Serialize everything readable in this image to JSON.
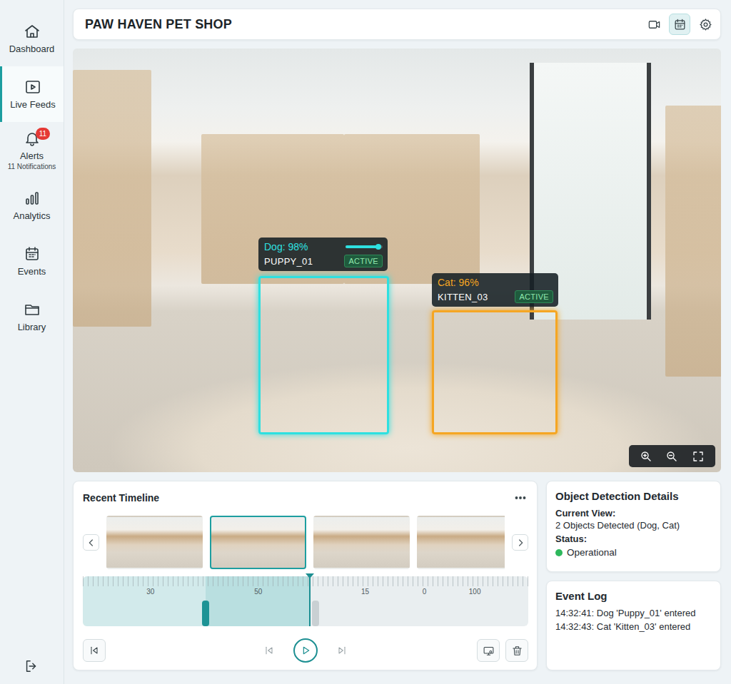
{
  "header": {
    "title": "PAW HAVEN PET SHOP",
    "buttons": [
      {
        "selected": false
      },
      {
        "selected": true
      },
      {
        "selected": false
      }
    ]
  },
  "sidebar": {
    "items": [
      {
        "label": "Dashboard",
        "selected": false
      },
      {
        "label": "Live Feeds",
        "selected": true
      },
      {
        "label": "Alerts",
        "selected": false,
        "badge": "11",
        "sublabel": "11 Notifications"
      },
      {
        "label": "Analytics",
        "selected": false
      },
      {
        "label": "Events",
        "selected": false
      },
      {
        "label": "Library",
        "selected": false
      }
    ]
  },
  "feed": {
    "detections": [
      {
        "label": "Dog: 98%",
        "id": "PUPPY_01",
        "status": "ACTIVE",
        "color": "#2ee0e0",
        "level": 0.9
      },
      {
        "label": "Cat: 96%",
        "id": "KITTEN_03",
        "status": "ACTIVE",
        "color": "#f5a623"
      }
    ]
  },
  "timeline": {
    "title": "Recent Timeline",
    "thumbnails": [
      {
        "selected": false
      },
      {
        "selected": true
      },
      {
        "selected": false
      },
      {
        "selected": false
      }
    ],
    "ticks": [
      "30",
      "50",
      "15",
      "0",
      "100"
    ],
    "level": 0.51,
    "range_start": 0.276
  },
  "details": {
    "title": "Object Detection Details",
    "current_view_label": "Current View:",
    "current_view": "2 Objects Detected (Dog, Cat)",
    "status_label": "Status:",
    "status": {
      "text": "Operational",
      "color": "#2eb85c"
    }
  },
  "event_log": {
    "title": "Event Log",
    "entries": [
      "14:32:41: Dog 'Puppy_01' entered",
      "14:32:43: Cat 'Kitten_03' entered"
    ]
  }
}
